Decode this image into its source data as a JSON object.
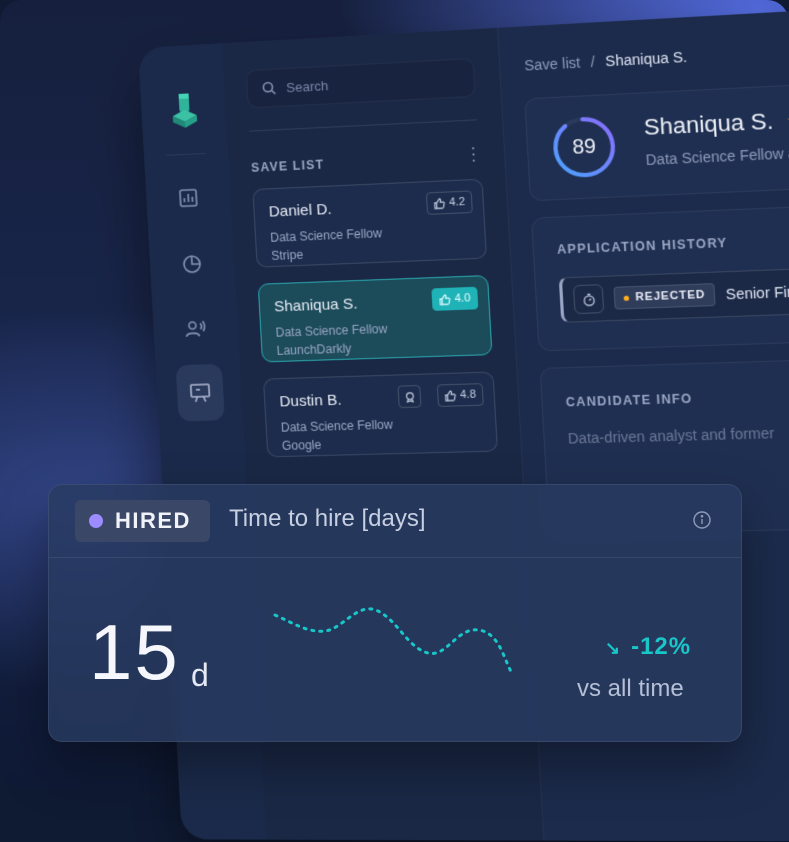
{
  "sidebar": {
    "icons": [
      "logo-icon",
      "bar-chart-icon",
      "pie-chart-icon",
      "people-icon",
      "presentation-icon"
    ]
  },
  "list_panel": {
    "search_placeholder": "Search",
    "section_title": "SAVE LIST",
    "candidates": [
      {
        "name": "Daniel D.",
        "role": "Data Science Fellow",
        "company": "Stripe",
        "score": "4.2",
        "selected": false
      },
      {
        "name": "Shaniqua S.",
        "role": "Data Science Fellow",
        "company": "LaunchDarkly",
        "score": "4.0",
        "selected": true
      },
      {
        "name": "Dustin B.",
        "role": "Data Science Fellow",
        "company": "Google",
        "score": "4.8",
        "selected": false
      }
    ]
  },
  "breadcrumb": {
    "parent": "Save list",
    "separator": "/",
    "current": "Shaniqua S."
  },
  "profile": {
    "score": "89",
    "score_fraction": 0.89,
    "name": "Shaniqua S.",
    "role": "Data Science Fellow a"
  },
  "application_history": {
    "title": "APPLICATION HISTORY",
    "entry": {
      "status": "REJECTED",
      "role": "Senior Fina"
    }
  },
  "candidate_info": {
    "title": "CANDIDATE INFO",
    "text": "Data-driven analyst and former"
  },
  "widget": {
    "badge": "HIRED",
    "title": "Time to hire [days]",
    "value": "15",
    "unit": "d",
    "delta": "-12%",
    "comparison": "vs all time",
    "colors": {
      "badge_dot": "#9c8cff",
      "accent": "#19c6c8",
      "star": "#ffb020"
    }
  }
}
